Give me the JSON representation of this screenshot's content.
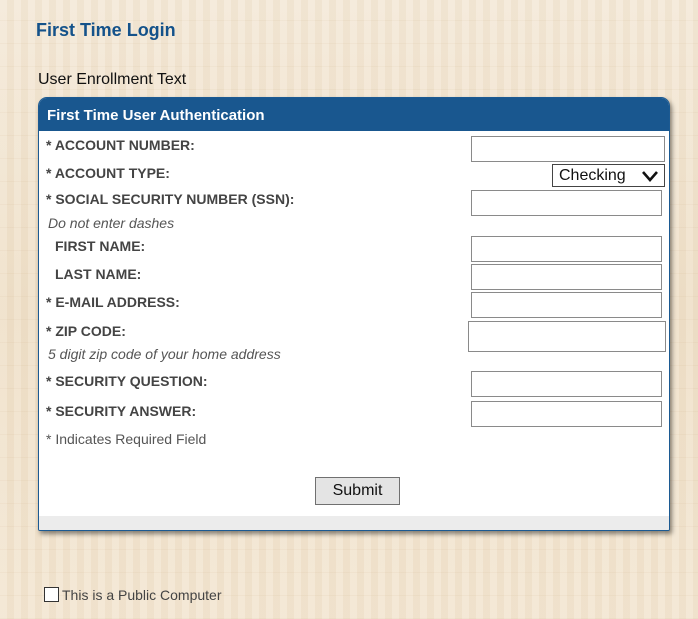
{
  "page": {
    "title": "First Time Login",
    "enrollment_text": "User Enrollment Text"
  },
  "panel": {
    "title": "First Time User Authentication",
    "fields": {
      "account_number": {
        "label": "* ACCOUNT NUMBER:",
        "value": ""
      },
      "account_type": {
        "label": "* ACCOUNT TYPE:",
        "selected": "Checking"
      },
      "ssn": {
        "label": "* SOCIAL SECURITY NUMBER (SSN):",
        "hint": "Do not enter dashes",
        "value": ""
      },
      "first_name": {
        "label": "FIRST NAME:",
        "value": ""
      },
      "last_name": {
        "label": "LAST NAME:",
        "value": ""
      },
      "email": {
        "label": "* E-MAIL ADDRESS:",
        "value": ""
      },
      "zip": {
        "label": "* ZIP CODE:",
        "hint": "5 digit zip code of your home address",
        "value": ""
      },
      "security_question": {
        "label": "* SECURITY QUESTION:",
        "value": ""
      },
      "security_answer": {
        "label": "* SECURITY ANSWER:",
        "value": ""
      }
    },
    "required_note": "* Indicates Required Field",
    "submit_label": "Submit"
  },
  "public_computer": {
    "label": "This is a Public Computer",
    "checked": false
  },
  "colors": {
    "accent": "#19578f",
    "title": "#14528a",
    "background": "#f1e4d0"
  }
}
